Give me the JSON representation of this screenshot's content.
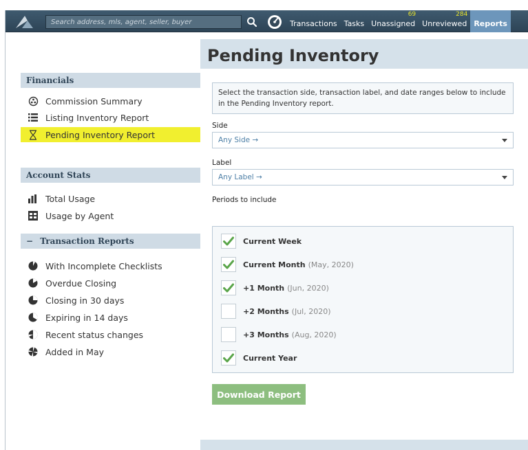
{
  "search": {
    "placeholder": "Search address, mls, agent, seller, buyer"
  },
  "nav": {
    "transactions": "Transactions",
    "tasks": "Tasks",
    "unassigned": "Unassigned",
    "unassigned_count": "69",
    "unreviewed": "Unreviewed",
    "unreviewed_count": "284",
    "reports": "Reports"
  },
  "sidebar": {
    "financials": {
      "title": "Financials",
      "items": [
        "Commission Summary",
        "Listing Inventory Report",
        "Pending Inventory Report"
      ]
    },
    "account_stats": {
      "title": "Account Stats",
      "items": [
        "Total Usage",
        "Usage by Agent"
      ]
    },
    "transaction_reports": {
      "title": "Transaction Reports",
      "toggle": "−",
      "items": [
        "With Incomplete Checklists",
        "Overdue Closing",
        "Closing in 30 days",
        "Expiring in 14 days",
        "Recent status changes",
        "Added in May"
      ]
    }
  },
  "main": {
    "title": "Pending Inventory",
    "info": "Select the transaction side, transaction label, and date ranges below to include in the Pending Inventory report.",
    "side_label": "Side",
    "side_value": "Any Side →",
    "label_label": "Label",
    "label_value": "Any Label →",
    "periods_label": "Periods to include",
    "periods": [
      {
        "label": "Current Week",
        "detail": "",
        "checked": true
      },
      {
        "label": "Current Month",
        "detail": "(May, 2020)",
        "checked": true
      },
      {
        "label": "+1 Month",
        "detail": "(Jun, 2020)",
        "checked": true
      },
      {
        "label": "+2 Months",
        "detail": "(Jul, 2020)",
        "checked": false
      },
      {
        "label": "+3 Months",
        "detail": "(Aug, 2020)",
        "checked": false
      },
      {
        "label": "Current Year",
        "detail": "",
        "checked": true
      }
    ],
    "download": "Download Report"
  },
  "colors": {
    "topbar": "#34495a",
    "active_nav": "#6d96bb",
    "highlight": "#f1ef2f",
    "section_header": "#cfdbe5",
    "check_green": "#5aa54a",
    "download_button": "#8dbe7f"
  }
}
